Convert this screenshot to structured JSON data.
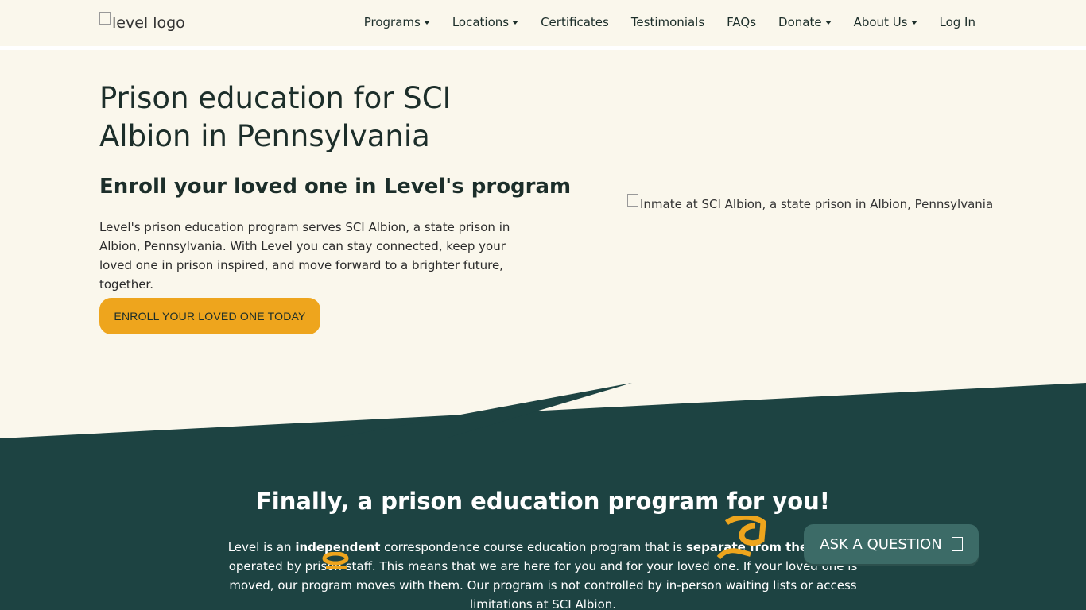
{
  "header": {
    "logo_alt": "level logo",
    "nav": [
      {
        "label": "Programs",
        "dropdown": true
      },
      {
        "label": "Locations",
        "dropdown": true
      },
      {
        "label": "Certificates",
        "dropdown": false
      },
      {
        "label": "Testimonials",
        "dropdown": false
      },
      {
        "label": "FAQs",
        "dropdown": false
      },
      {
        "label": "Donate",
        "dropdown": true
      },
      {
        "label": "About Us",
        "dropdown": true
      },
      {
        "label": "Log In",
        "dropdown": false
      }
    ]
  },
  "hero": {
    "title": "Prison education for SCI Albion in Pennsylvania",
    "subtitle": "Enroll your loved one in Level's program",
    "text": "Level's prison education program serves SCI Albion, a state prison in Albion, Pennsylvania. With Level you can stay connected, keep your loved one in prison inspired, and move forward to a brighter future, together.",
    "cta_label": "ENROLL YOUR LOVED ONE TODAY",
    "image_alt": "Inmate at SCI Albion, a state prison in Albion, Pennsylvania"
  },
  "intro": {
    "title": "Finally, a prison education program for you!",
    "text_parts": {
      "p1": "Level is an ",
      "b1": "independent",
      "p2": " correspondence course education program that is ",
      "b2": "separate from the facility",
      "p3": " operated by prison staff. This means that we are here for you and for your loved one. If your loved one is moved, our program moves with them. Our program is not controlled by in-person waiting lists or access limitations at SCI Albion."
    }
  },
  "chat": {
    "label": "ASK A QUESTION"
  },
  "colors": {
    "background": "#faf7ec",
    "dark_green": "#1d4342",
    "accent": "#eea51d",
    "chat_button": "#3c6b67"
  }
}
